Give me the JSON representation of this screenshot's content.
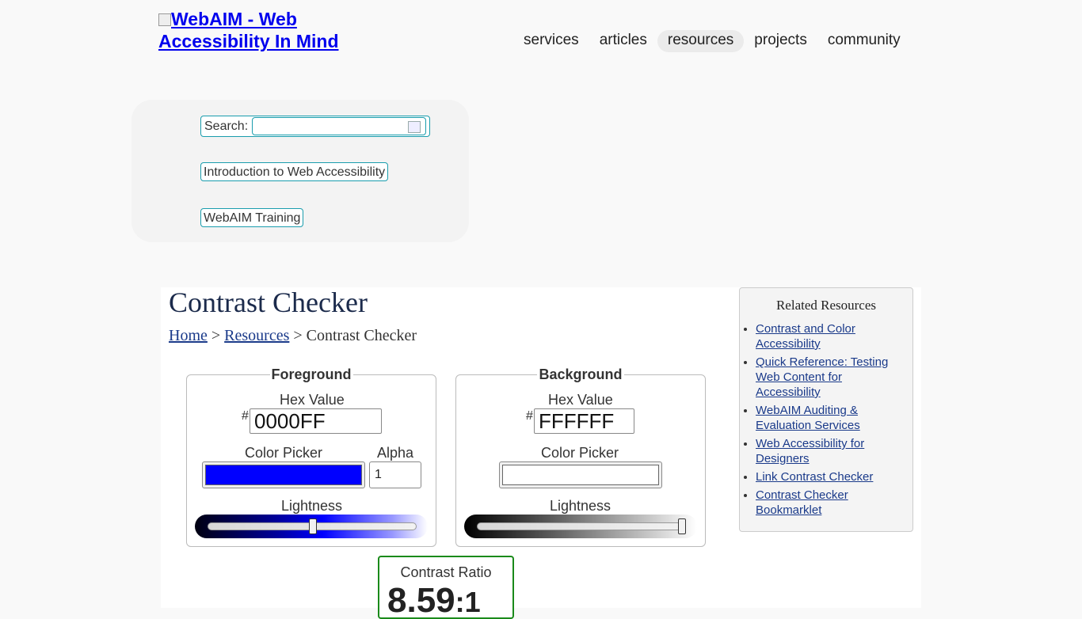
{
  "header": {
    "logo_alt": "WebAIM - Web Accessibility In Mind",
    "nav": [
      "services",
      "articles",
      "resources",
      "projects",
      "community"
    ]
  },
  "search": {
    "label": "Search:",
    "value": "",
    "links": [
      "Introduction to Web Accessibility",
      "WebAIM Training"
    ]
  },
  "page": {
    "title": "Contrast Checker",
    "breadcrumb": {
      "home": "Home",
      "resources": "Resources",
      "current": "Contrast Checker",
      "sep": ">"
    }
  },
  "foreground": {
    "legend": "Foreground",
    "hex_label": "Hex Value",
    "hash": "#",
    "hex": "0000FF",
    "picker_label": "Color Picker",
    "alpha_label": "Alpha",
    "alpha": "1",
    "lightness_label": "Lightness",
    "lightness_fraction": 0.5,
    "swatch_color": "#0000FF"
  },
  "background": {
    "legend": "Background",
    "hex_label": "Hex Value",
    "hash": "#",
    "hex": "FFFFFF",
    "picker_label": "Color Picker",
    "lightness_label": "Lightness",
    "lightness_fraction": 1.0,
    "swatch_color": "#FFFFFF"
  },
  "contrast": {
    "label": "Contrast Ratio",
    "value": "8.59",
    "suffix": ":1",
    "border_color": "#1A8A1A"
  },
  "related": {
    "title": "Related Resources",
    "items": [
      "Contrast and Color Accessibility",
      "Quick Reference: Testing Web Content for Accessibility",
      "WebAIM Auditing & Evaluation Services",
      "Web Accessibility for Designers",
      "Link Contrast Checker",
      "Contrast Checker Bookmarklet"
    ]
  }
}
